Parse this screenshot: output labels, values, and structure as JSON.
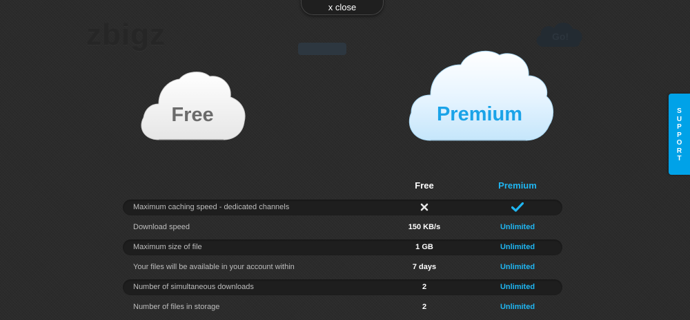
{
  "close": {
    "label": "x close"
  },
  "background": {
    "logo_text": "zbigz",
    "go_text": "Go!"
  },
  "clouds": {
    "free_label": "Free",
    "premium_label": "Premium"
  },
  "support": {
    "letters": [
      "S",
      "U",
      "P",
      "P",
      "O",
      "R",
      "T"
    ]
  },
  "table": {
    "headers": {
      "free": "Free",
      "premium": "Premium"
    },
    "rows": [
      {
        "label": "Maximum caching speed - dedicated channels",
        "free": "",
        "free_icon": "cross-icon",
        "premium": "",
        "premium_icon": "check-icon"
      },
      {
        "label": "Download speed",
        "free": "150 KB/s",
        "premium": "Unlimited"
      },
      {
        "label": "Maximum size of file",
        "free": "1 GB",
        "premium": "Unlimited"
      },
      {
        "label": "Your files will be available in your account within",
        "free": "7 days",
        "premium": "Unlimited"
      },
      {
        "label": "Number of simultaneous downloads",
        "free": "2",
        "premium": "Unlimited"
      },
      {
        "label": "Number of files in storage",
        "free": "2",
        "premium": "Unlimited"
      }
    ]
  },
  "colors": {
    "accent": "#1fb6f2",
    "support_bg": "#00a2e8",
    "background": "#2b2b2b",
    "row_shade": "#1e1e1e"
  }
}
